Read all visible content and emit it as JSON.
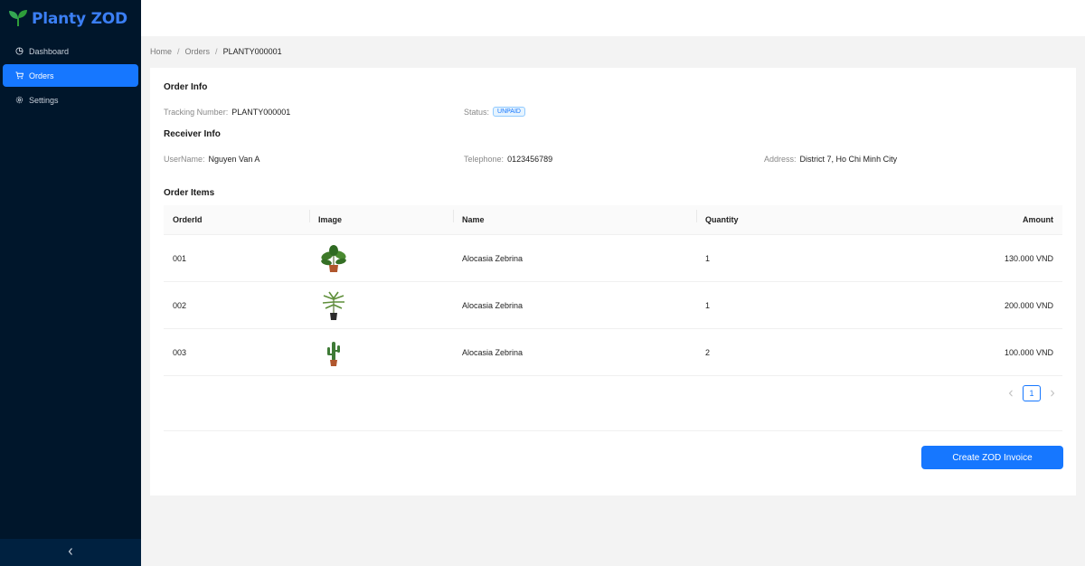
{
  "app": {
    "name": "Planty ZOD",
    "accent_color": "#1677ff"
  },
  "sidebar": {
    "items": [
      {
        "label": "Dashboard",
        "icon": "pie-chart-icon",
        "active": false
      },
      {
        "label": "Orders",
        "icon": "shopping-cart-icon",
        "active": true
      },
      {
        "label": "Settings",
        "icon": "gear-icon",
        "active": false
      }
    ],
    "collapse_icon": "chevron-left-icon"
  },
  "breadcrumb": [
    "Home",
    "Orders",
    "PLANTY000001"
  ],
  "order_info": {
    "title": "Order Info",
    "tracking_label": "Tracking Number",
    "tracking_value": "PLANTY000001",
    "status_label": "Status",
    "status_value": "UNPAID"
  },
  "receiver_info": {
    "title": "Receiver Info",
    "username_label": "UserName",
    "username_value": "Nguyen Van A",
    "telephone_label": "Telephone",
    "telephone_value": "0123456789",
    "address_label": "Address",
    "address_value": "District 7, Ho Chi Minh City"
  },
  "order_items": {
    "title": "Order Items",
    "columns": [
      "OrderId",
      "Image",
      "Name",
      "Quantity",
      "Amount"
    ],
    "rows": [
      {
        "id": "001",
        "image": "plant-image",
        "name": "Alocasia Zebrina",
        "quantity": "1",
        "amount": "130.000 VND"
      },
      {
        "id": "002",
        "image": "plant-image",
        "name": "Alocasia Zebrina",
        "quantity": "1",
        "amount": "200.000 VND"
      },
      {
        "id": "003",
        "image": "plant-image",
        "name": "Alocasia Zebrina",
        "quantity": "2",
        "amount": "100.000 VND"
      }
    ]
  },
  "pagination": {
    "current_page": "1"
  },
  "actions": {
    "create_invoice_label": "Create ZOD Invoice"
  }
}
